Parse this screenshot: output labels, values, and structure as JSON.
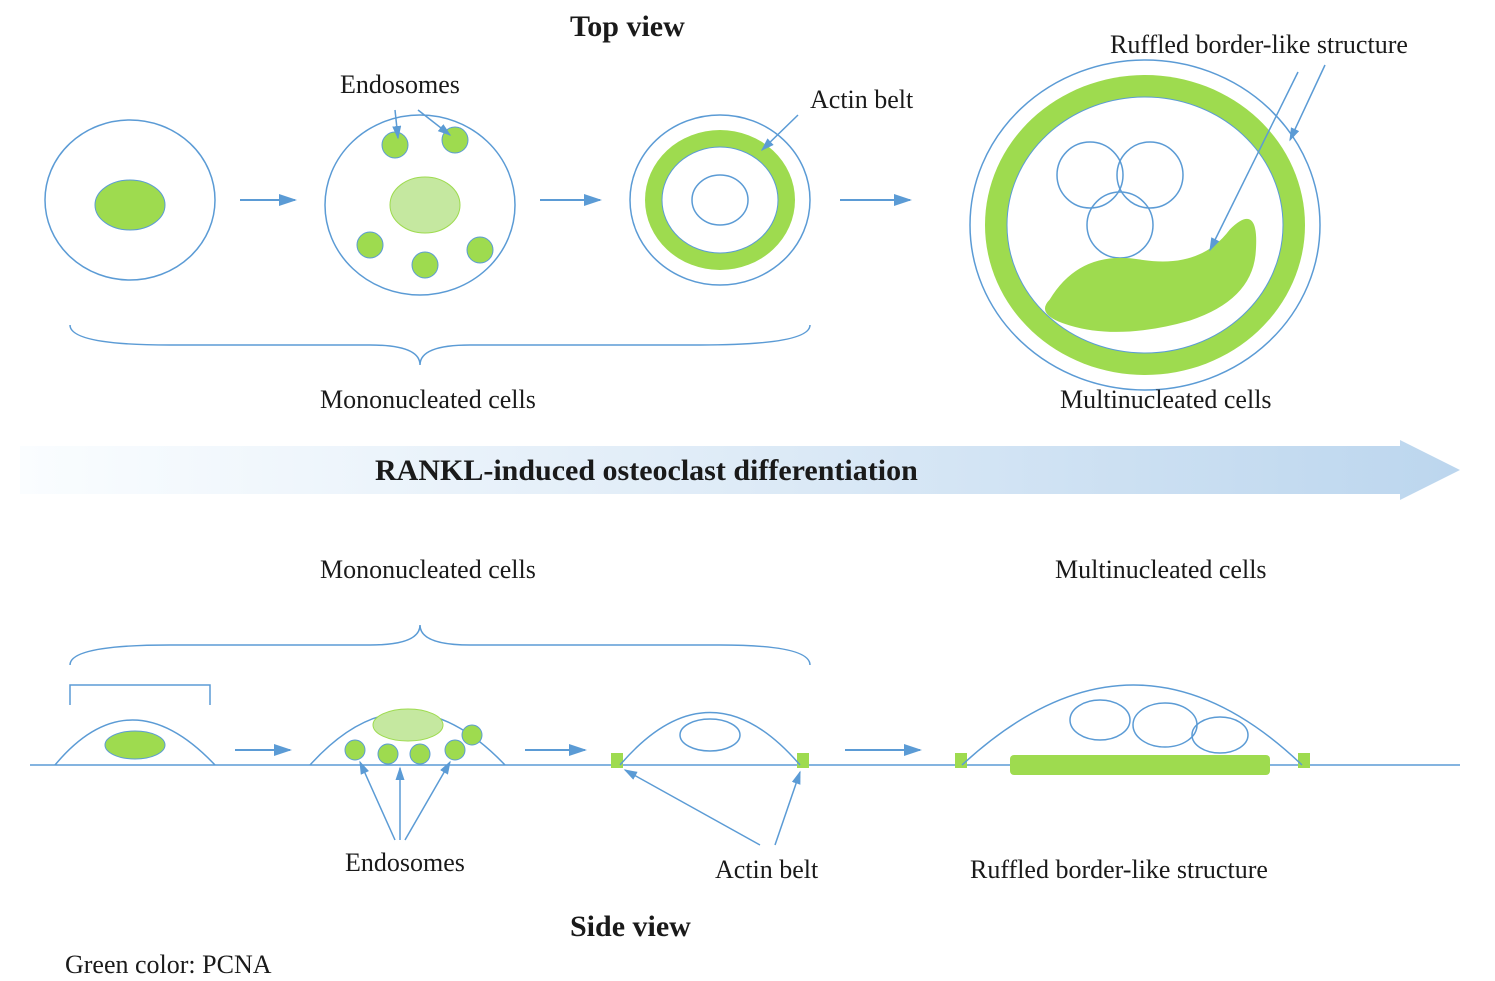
{
  "title_top": "Top view",
  "title_side": "Side view",
  "labels": {
    "endosomes_top": "Endosomes",
    "actin_belt_top": "Actin belt",
    "ruffled_top": "Ruffled border-like structure",
    "mono_top": "Mononucleated cells",
    "multi_top": "Multinucleated  cells",
    "main_arrow": "RANKL-induced  osteoclast differentiation",
    "mono_side": "Mononucleated cells",
    "multi_side": "Multinucleated  cells",
    "endosomes_side": "Endosomes",
    "actin_belt_side": "Actin belt",
    "ruffled_side": "Ruffled border-like structure",
    "legend": "Green color: PCNA"
  },
  "colors": {
    "green_fill": "#9edb4f",
    "green_light": "#c5e8a0",
    "blue_stroke": "#5b9bd5",
    "blue_fill_light": "#deebf7",
    "text": "#1a1a1a"
  }
}
